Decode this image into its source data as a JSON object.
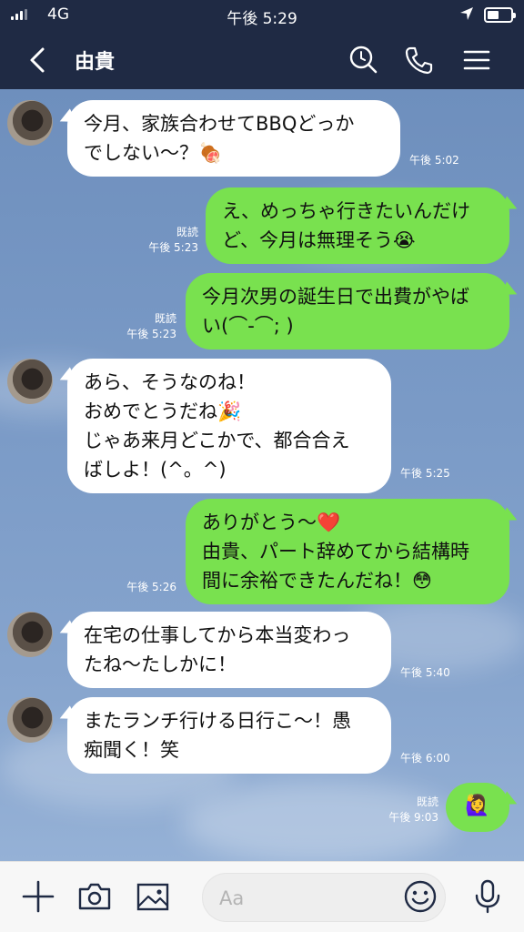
{
  "status": {
    "carrier": "4G",
    "time": "午後 5:29"
  },
  "header": {
    "contact_name": "由貴"
  },
  "messages": [
    {
      "dir": "in",
      "lines": [
        "今月、家族合わせてBBQどっか",
        "でしない〜？🍖"
      ],
      "time": "午後 5:02"
    },
    {
      "dir": "out",
      "lines": [
        "え、めっちゃ行きたいんだけ",
        "ど、今月は無理そう😭"
      ],
      "read": "既読",
      "time": "午後 5:23"
    },
    {
      "dir": "out",
      "lines": [
        "今月次男の誕生日で出費がやば",
        "い(⌒-⌒; )"
      ],
      "read": "既読",
      "time": "午後 5:23"
    },
    {
      "dir": "in",
      "lines": [
        "あら、そうなのね！",
        "おめでとうだね🎉",
        "じゃあ来月どこかで、都合合え",
        "ばしよ！(^。^)"
      ],
      "time": "午後 5:25"
    },
    {
      "dir": "out",
      "lines": [
        "ありがとう〜❤️",
        "由貴、パート辞めてから結構時",
        "間に余裕できたんだね！😳"
      ],
      "time": "午後 5:26"
    },
    {
      "dir": "in",
      "lines": [
        "在宅の仕事してから本当変わっ",
        "たね〜たしかに！"
      ],
      "time": "午後 5:40"
    },
    {
      "dir": "in",
      "lines": [
        "またランチ行ける日行こ〜！愚",
        "痴聞く！笑"
      ],
      "time": "午後 6:00"
    },
    {
      "dir": "out",
      "lines": [
        "🙋‍♀️"
      ],
      "read": "既読",
      "time": "午後 9:03"
    }
  ],
  "input": {
    "placeholder": "Aa"
  },
  "colors": {
    "header": "#1f2a44",
    "outgoing_bubble": "#79e14f",
    "incoming_bubble": "#ffffff",
    "chat_bg": "#7b9bc7"
  }
}
